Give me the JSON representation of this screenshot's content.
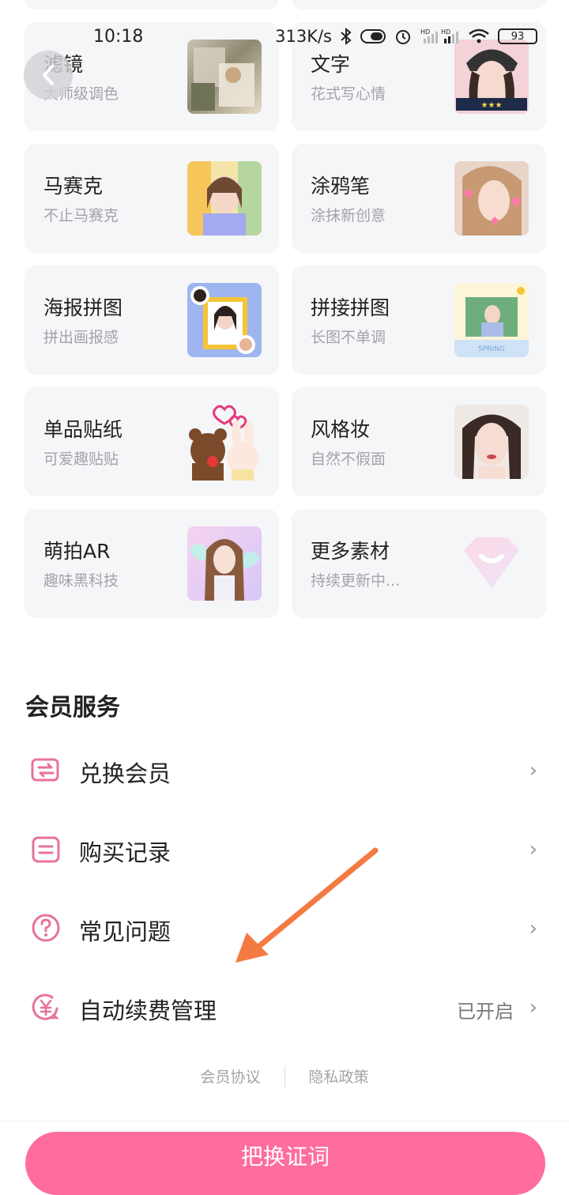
{
  "status_bar": {
    "time": "10:18",
    "speed": "313K/s",
    "battery": "93",
    "icons": [
      "bluetooth-icon",
      "toggle-icon",
      "alarm-icon",
      "signal-icon",
      "wifi-icon",
      "battery-icon"
    ]
  },
  "features": [
    {
      "title": "滤镜",
      "subtitle": "大师级调色",
      "thumb": "filter-thumbnail"
    },
    {
      "title": "文字",
      "subtitle": "花式写心情",
      "thumb": "text-thumbnail"
    },
    {
      "title": "马赛克",
      "subtitle": "不止马赛克",
      "thumb": "mosaic-thumbnail"
    },
    {
      "title": "涂鸦笔",
      "subtitle": "涂抹新创意",
      "thumb": "doodle-thumbnail"
    },
    {
      "title": "海报拼图",
      "subtitle": "拼出画报感",
      "thumb": "poster-thumbnail"
    },
    {
      "title": "拼接拼图",
      "subtitle": "长图不单调",
      "thumb": "stitch-thumbnail"
    },
    {
      "title": "单品贴纸",
      "subtitle": "可爱趣贴贴",
      "thumb": "sticker-thumbnail"
    },
    {
      "title": "风格妆",
      "subtitle": "自然不假面",
      "thumb": "makeup-thumbnail"
    },
    {
      "title": "萌拍AR",
      "subtitle": "趣味黑科技",
      "thumb": "ar-thumbnail"
    },
    {
      "title": "更多素材",
      "subtitle": "持续更新中...",
      "thumb": "more-diamond-icon"
    }
  ],
  "member": {
    "section_title": "会员服务",
    "items": [
      {
        "label": "兑换会员",
        "icon": "exchange-icon",
        "value": ""
      },
      {
        "label": "购买记录",
        "icon": "record-icon",
        "value": ""
      },
      {
        "label": "常见问题",
        "icon": "question-icon",
        "value": ""
      },
      {
        "label": "自动续费管理",
        "icon": "yen-icon",
        "value": "已开启"
      }
    ]
  },
  "links": {
    "agreement": "会员协议",
    "privacy": "隐私政策"
  },
  "bottom": {
    "button_label": "把换证词"
  },
  "colors": {
    "accent": "#ff6d9d",
    "icon_pink": "#e8739a",
    "arrow": "#f47a43",
    "card_bg": "#f5f6f8"
  }
}
